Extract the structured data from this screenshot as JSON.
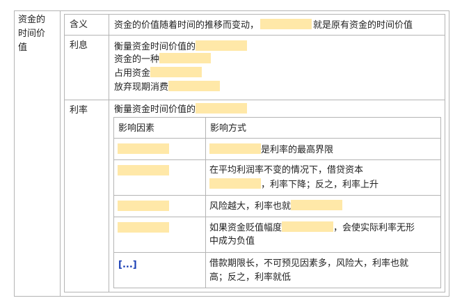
{
  "topic": "资金的时间价值",
  "topic_lines": [
    "资金的",
    "时间价",
    "值"
  ],
  "rows": {
    "meaning": {
      "label": "含义",
      "text_before": "资金的价值随着时间的推移而变动，",
      "text_after": "就是原有资金的时间价值"
    },
    "interest": {
      "label": "利息",
      "lines": [
        "衡量资金时间价值的",
        "资金的一种",
        "占用资金",
        "放弃现期消费"
      ]
    },
    "rate": {
      "label": "利率",
      "intro": "衡量资金时间价值的",
      "table": {
        "headers": [
          "影响因素",
          "影响方式"
        ],
        "rows": [
          {
            "effect_after_blank": "是利率的最高界限"
          },
          {
            "effect_line1": "在平均利润率不变的情况下，借贷资本",
            "effect_line2_after_blank": "，利率下降；反之，利率上升"
          },
          {
            "effect_before_blank": "风险越大，利率也就"
          },
          {
            "effect_line1_before_blank": "如果资金贬值幅度",
            "effect_line1_after_blank": "，会使实际利率无形",
            "effect_line2": "中成为负值"
          },
          {
            "factor_link": "[...]",
            "effect_line1": "借款期限长，不可预见因素多，风险大，利率也就",
            "effect_line2": "高；反之，利率就低"
          }
        ]
      }
    }
  }
}
